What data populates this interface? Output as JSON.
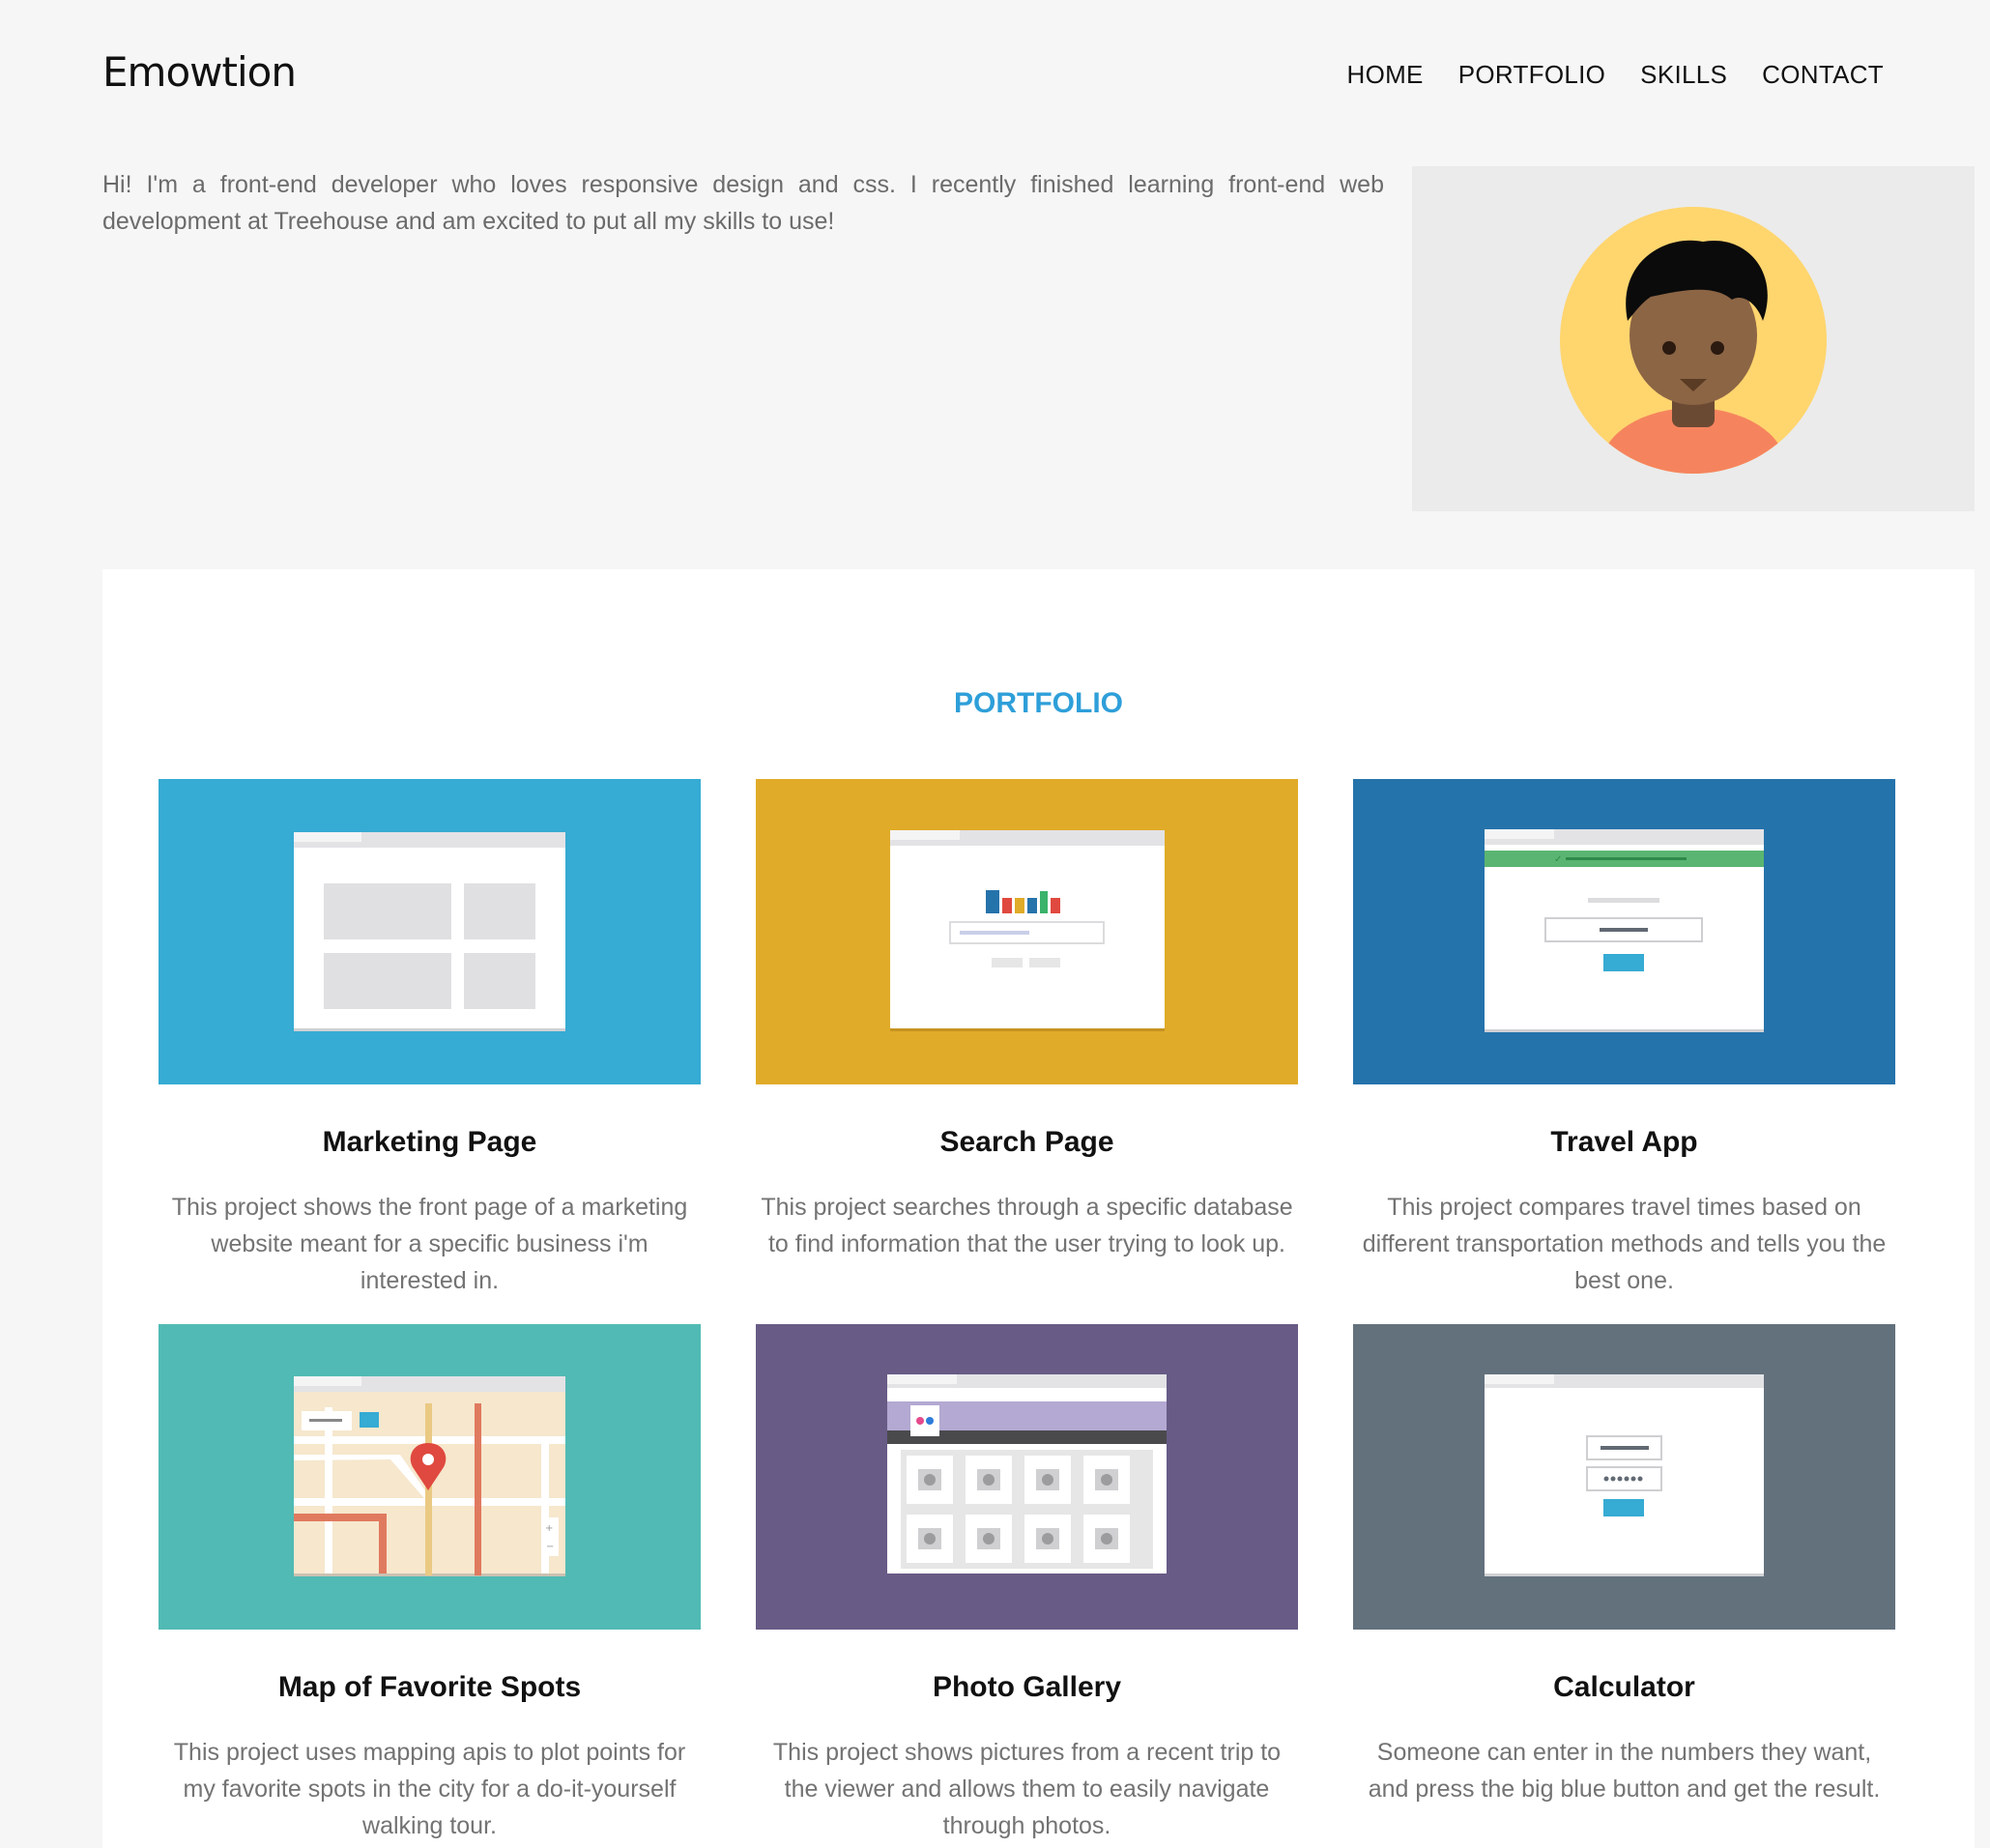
{
  "header": {
    "logo": "Emowtion",
    "nav": [
      "HOME",
      "PORTFOLIO",
      "SKILLS",
      "CONTACT"
    ]
  },
  "intro": {
    "text": "Hi! I'm a front-end developer who loves responsive design and css. I recently finished learning front-end web development at Treehouse and am excited to put all my skills to use!"
  },
  "portfolio": {
    "title": "PORTFOLIO",
    "projects": [
      {
        "title": "Marketing Page",
        "description": "This project shows the front page of a marketing website meant for a specific business i'm interested in.",
        "color": "#36abd3",
        "icon": "marketing-page-thumbnail"
      },
      {
        "title": "Search Page",
        "description": "This project searches through a specific database to find information that the user trying to look up.",
        "color": "#e0ab28",
        "icon": "search-page-thumbnail"
      },
      {
        "title": "Travel App",
        "description": "This project compares travel times based on different transportation methods and tells you the best one.",
        "color": "#2573ab",
        "icon": "travel-app-thumbnail"
      },
      {
        "title": "Map of Favorite Spots",
        "description": "This project uses mapping apis to plot points for my favorite spots in the city for a do-it-yourself walking tour.",
        "color": "#51bab4",
        "icon": "map-thumbnail"
      },
      {
        "title": "Photo Gallery",
        "description": "This project shows pictures from a recent trip to the viewer and allows them to easily navigate through photos.",
        "color": "#685b86",
        "icon": "photo-gallery-thumbnail"
      },
      {
        "title": "Calculator",
        "description": "Someone can enter in the numbers they want, and press the big blue button and get the result.",
        "color": "#63717d",
        "icon": "calculator-thumbnail"
      }
    ]
  },
  "colors": {
    "page_bg": "#f6f6f6",
    "accent": "#2e9fd9",
    "text_muted": "#737373"
  }
}
